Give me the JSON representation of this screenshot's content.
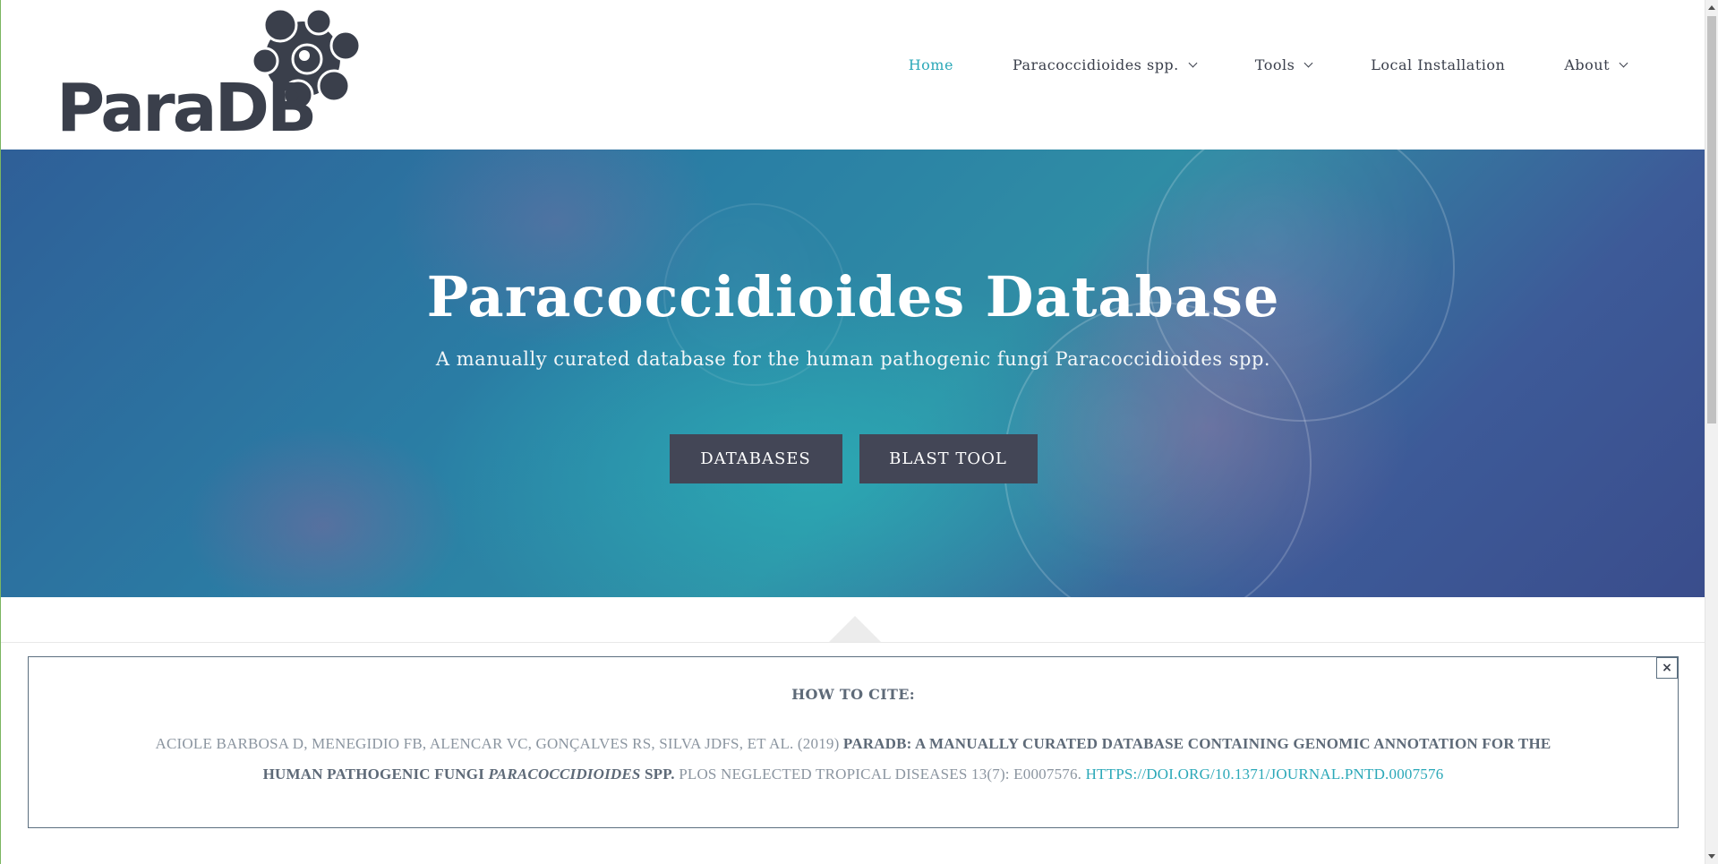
{
  "header": {
    "logo_text": "ParaDB",
    "nav": [
      {
        "label": "Home",
        "active": true,
        "has_dropdown": false
      },
      {
        "label": "Paracoccidioides spp.",
        "active": false,
        "has_dropdown": true
      },
      {
        "label": "Tools",
        "active": false,
        "has_dropdown": true
      },
      {
        "label": "Local Installation",
        "active": false,
        "has_dropdown": false
      },
      {
        "label": "About",
        "active": false,
        "has_dropdown": true
      }
    ]
  },
  "hero": {
    "title": "Paracoccidioides Database",
    "subtitle": "A manually curated database for the human pathogenic fungi Paracoccidioides spp.",
    "buttons": {
      "databases": "DATABASES",
      "blast": "BLAST TOOL"
    }
  },
  "cite": {
    "heading": "HOW TO CITE:",
    "authors": "Aciole Barbosa D, Menegidio FB, Alencar VC, Gonçalves RS, Silva JDFS, et al. (2019)",
    "title_part1": "ParaDB: A manually curated database containing genomic annotation for the human pathogenic fungi",
    "title_italic": "Paracoccidioides",
    "title_part2": "spp.",
    "journal": "PLoS Neglected Tropical Diseases 13(7): e0007576.",
    "link": "https://doi.org/10.1371/journal.pntd.0007576",
    "close_label": "×"
  },
  "colors": {
    "accent": "#2ba8b8",
    "button_bg": "#434656",
    "text_dark": "#3a3f4b"
  }
}
